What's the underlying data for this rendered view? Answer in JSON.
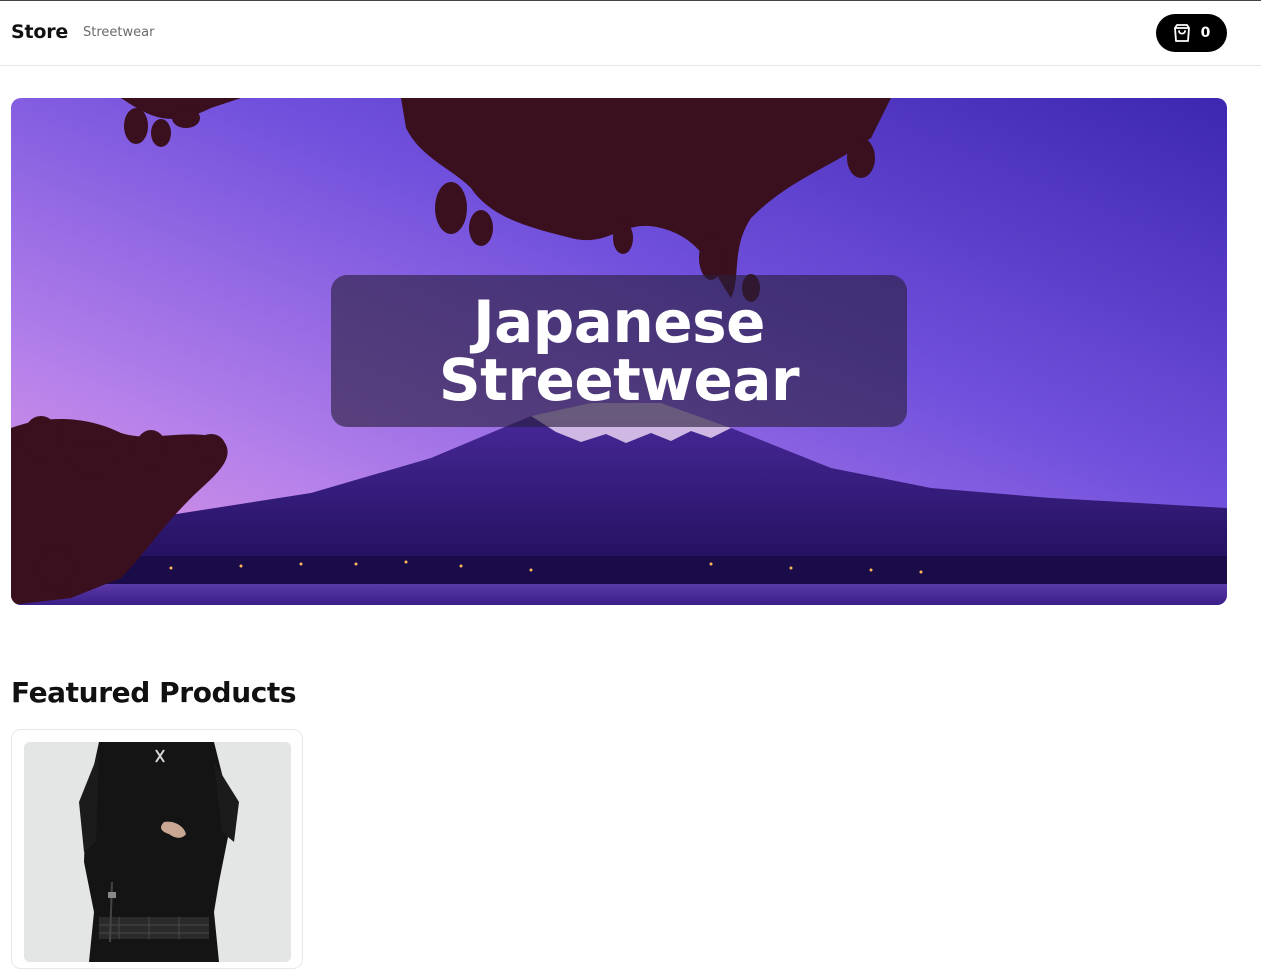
{
  "navbar": {
    "brand": "Store",
    "links": [
      "Streetwear"
    ],
    "cart_count": "0"
  },
  "hero": {
    "title": "Japanese Streetwear"
  },
  "featured": {
    "heading": "Featured Products"
  },
  "icons": {
    "cart": "shopping-bag-icon"
  }
}
